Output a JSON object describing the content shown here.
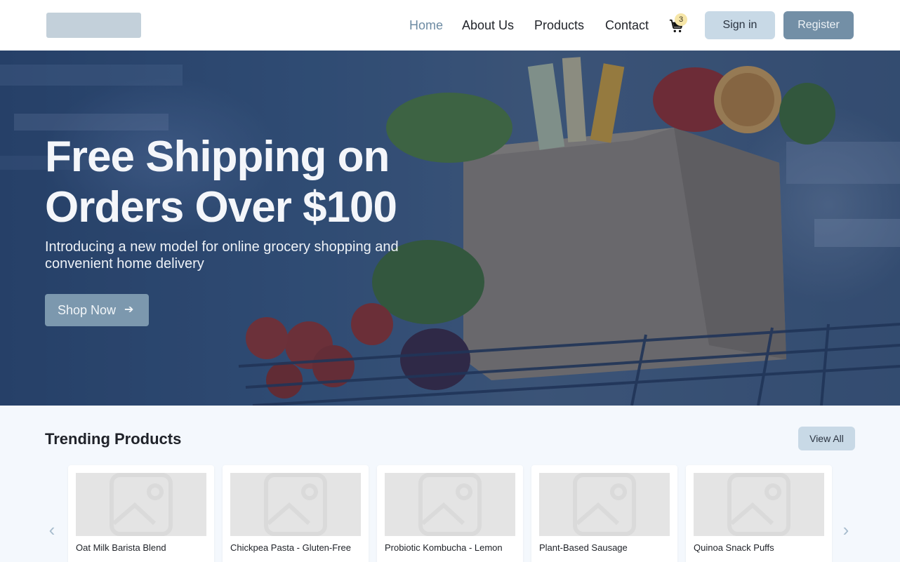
{
  "header": {
    "logo": "logo",
    "nav": [
      {
        "label": "Home",
        "active": true
      },
      {
        "label": "About Us",
        "active": false
      },
      {
        "label": "Products",
        "active": false
      },
      {
        "label": "Contact",
        "active": false
      }
    ],
    "cart_icon": "cart-icon",
    "cart_count": "3",
    "sign_in_label": "Sign in",
    "register_label": "Register"
  },
  "hero": {
    "title": "Free Shipping on Orders Over $100",
    "subtitle": "Introducing a new model for online grocery shopping and convenient home delivery",
    "cta_label": "Shop Now",
    "cta_icon": "arrow-right-icon"
  },
  "trending": {
    "title": "Trending Products",
    "view_all_label": "View All",
    "prev_icon": "chevron-left-icon",
    "next_icon": "chevron-right-icon",
    "products": [
      {
        "name": "Oat Milk Barista Blend",
        "image_icon": "image-placeholder-icon"
      },
      {
        "name": "Chickpea Pasta - Gluten-Free",
        "image_icon": "image-placeholder-icon"
      },
      {
        "name": "Probiotic Kombucha - Lemon",
        "image_icon": "image-placeholder-icon"
      },
      {
        "name": "Plant-Based Sausage",
        "image_icon": "image-placeholder-icon"
      },
      {
        "name": "Quinoa Snack Puffs",
        "image_icon": "image-placeholder-icon"
      }
    ]
  },
  "colors": {
    "accent": "#738fa6",
    "accent_light": "#c8d9e6",
    "nav_active": "#6d8ba3",
    "page_bg": "#f4f8fd"
  }
}
